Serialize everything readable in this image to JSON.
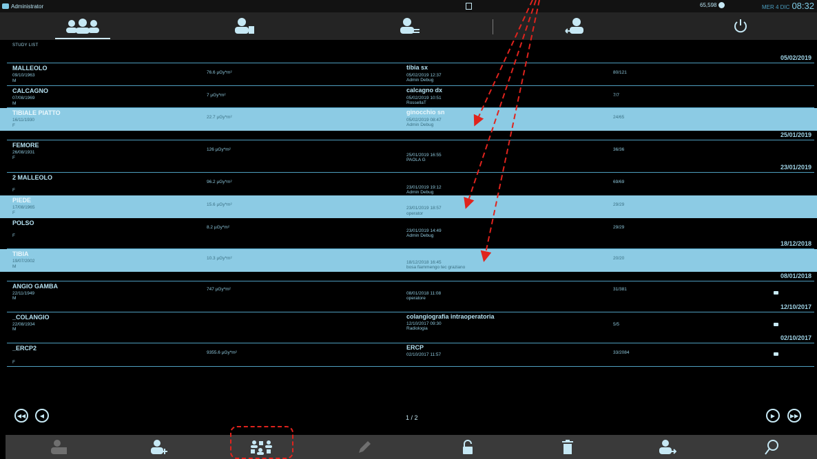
{
  "status": {
    "user": "Administrator",
    "disk": "65,598",
    "date": "MER 4 DIC",
    "time": "08:32"
  },
  "section_label": "STUDY LIST",
  "date_headers": {
    "d1": "05/02/2019",
    "d2": "25/01/2019",
    "d3": "23/01/2019",
    "d4": "18/12/2018",
    "d5": "08/01/2018",
    "d6": "12/10/2017",
    "d7": "02/10/2017"
  },
  "rows": [
    {
      "name": "MALLEOLO",
      "dob": "09/10/1963",
      "sex": "M",
      "dose": "76.6 µGy*m²",
      "desc": "tibia sx",
      "datetime": "05/02/2019 12:37",
      "operator": "Admin Debug",
      "count": "80/121"
    },
    {
      "name": "CALCAGNO",
      "dob": "07/08/1969",
      "sex": "M",
      "dose": "7 µGy*m²",
      "desc": "calcagno dx",
      "datetime": "05/02/2019 10:51",
      "operator": "RossellaT",
      "count": "7/7"
    },
    {
      "name": "TIBIALE PIATTO",
      "dob": "16/11/1930",
      "sex": "F",
      "dose": "22.7 µGy*m²",
      "desc": "ginocchio sn",
      "datetime": "05/02/2019 08:47",
      "operator": "Admin Debug",
      "count": "24/65"
    },
    {
      "name": "FEMORE",
      "dob": "26/08/1931",
      "sex": "F",
      "dose": "126 µGy*m²",
      "desc": "",
      "datetime": "25/01/2019 16:55",
      "operator": "PAOLA G",
      "count": "36/36"
    },
    {
      "name": "2 MALLEOLO",
      "dob": "",
      "sex": "F",
      "dose": "96.2 µGy*m²",
      "desc": "",
      "datetime": "23/01/2019 19:12",
      "operator": "Admin Debug",
      "count": "69/69"
    },
    {
      "name": "PIEDE",
      "dob": "17/08/1965",
      "sex": "F",
      "dose": "15.6 µGy*m²",
      "desc": "",
      "datetime": "23/01/2019 18:57",
      "operator": "operator",
      "count": "29/29"
    },
    {
      "name": "POLSO",
      "dob": "",
      "sex": "F",
      "dose": "8.2 µGy*m²",
      "desc": "",
      "datetime": "23/01/2019 14:49",
      "operator": "Admin Debug",
      "count": "29/29"
    },
    {
      "name": "TIBIA",
      "dob": "19/07/2002",
      "sex": "M",
      "dose": "10.3 µGy*m²",
      "desc": "",
      "datetime": "18/12/2018 16:45",
      "operator": "bosa fiammengo   tec graziano",
      "count": "20/20"
    },
    {
      "name": "ANGIO GAMBA",
      "dob": "22/11/1949",
      "sex": "M",
      "dose": "747 µGy*m²",
      "desc": "",
      "datetime": "08/01/2018 11:08",
      "operator": "operatore",
      "count": "31/381"
    },
    {
      "name": "_COLANGIO",
      "dob": "22/08/1934",
      "sex": "M",
      "dose": "",
      "desc": "colangiografia intraoperatoria",
      "datetime": "12/10/2017 09:30",
      "operator": "Radiologia",
      "count": "5/5"
    },
    {
      "name": "_ERCP2",
      "dob": "",
      "sex": "F",
      "dose": "9355.6 µGy*m²",
      "desc": "ERCP",
      "datetime": "02/10/2017 11:57",
      "operator": "",
      "count": "33/2084"
    }
  ],
  "pager": {
    "page": "1 / 2",
    "first_icon": "rewind-icon",
    "prev_icon": "prev-icon",
    "next_icon": "next-icon",
    "last_icon": "fast-forward-icon"
  },
  "colors": {
    "accent": "#8ccbe4",
    "annotation": "#e0231d"
  }
}
